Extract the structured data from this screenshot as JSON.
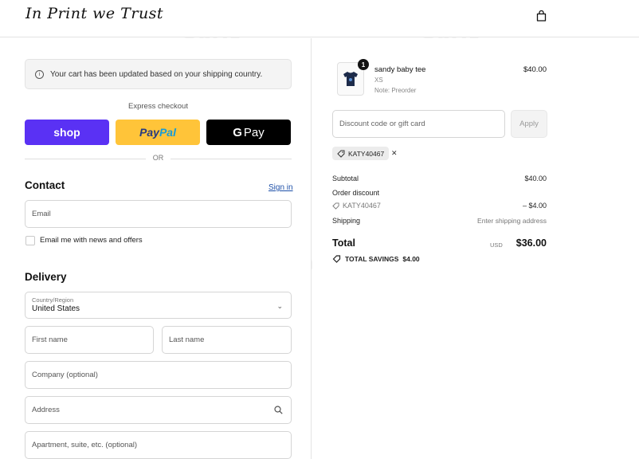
{
  "header": {
    "logo_text": "In Print we Trust",
    "cart_icon": "shopping-bag-icon"
  },
  "notice": {
    "text": "Your cart has been updated based on your shipping country.",
    "icon": "info-icon"
  },
  "express": {
    "label": "Express checkout",
    "shop_label": "shop",
    "paypal_part1": "Pay",
    "paypal_part2": "Pal",
    "gpay_g": "G",
    "gpay_label": "Pay",
    "or_text": "OR"
  },
  "contact": {
    "title": "Contact",
    "signin_label": "Sign in",
    "email_placeholder": "Email",
    "newsletter_label": "Email me with news and offers"
  },
  "delivery": {
    "title": "Delivery",
    "country_label": "Country/Region",
    "country_value": "United States",
    "first_name_placeholder": "First name",
    "last_name_placeholder": "Last name",
    "company_placeholder": "Company (optional)",
    "address_placeholder": "Address",
    "apartment_placeholder": "Apartment, suite, etc. (optional)"
  },
  "order": {
    "item": {
      "quantity": "1",
      "name": "sandy baby tee",
      "variant": "XS",
      "note": "Note: Preorder",
      "price": "$40.00"
    },
    "discount_placeholder": "Discount code or gift card",
    "apply_label": "Apply",
    "applied_code": "KATY40467",
    "subtotal_label": "Subtotal",
    "subtotal_value": "$40.00",
    "order_discount_label": "Order discount",
    "discount_code": "KATY40467",
    "discount_value": "– $4.00",
    "shipping_label": "Shipping",
    "shipping_value": "Enter shipping address",
    "total_label": "Total",
    "total_currency": "USD",
    "total_value": "$36.00",
    "savings_label": "TOTAL SAVINGS",
    "savings_value": "$4.00"
  },
  "watermark_text": "Tenereteam",
  "colors": {
    "shop": "#5a31f4",
    "paypal": "#ffc439",
    "gpay": "#000000",
    "link": "#1d4fa8"
  }
}
